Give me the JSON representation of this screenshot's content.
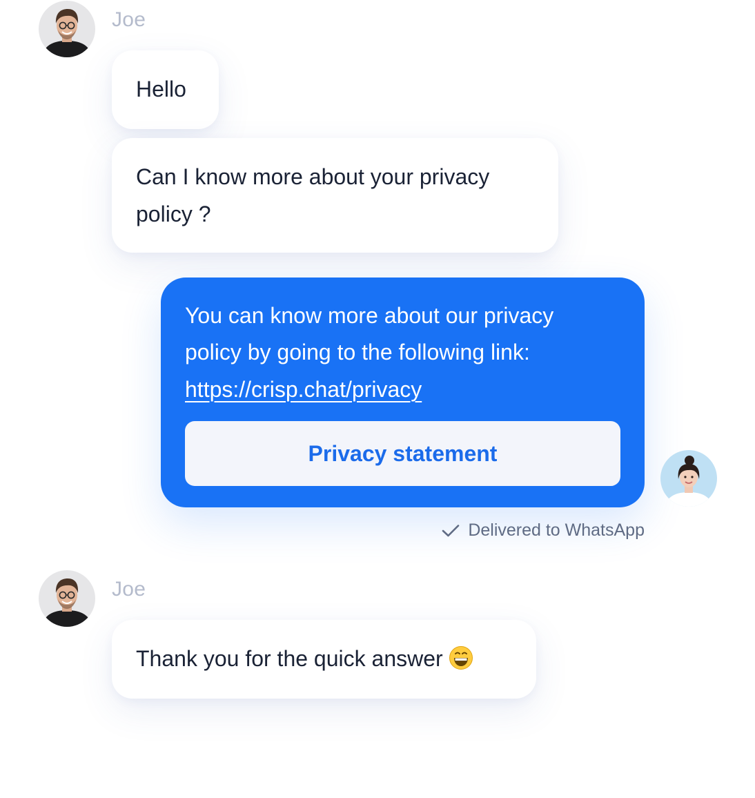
{
  "conversation": {
    "first_group": {
      "sender": "Joe",
      "messages": [
        "Hello",
        "Can I know more about your privacy\npolicy ?"
      ]
    },
    "operator_reply": {
      "text": "You can know more about our privacy\npolicy by going to the following link:",
      "link": "https://crisp.chat/privacy",
      "button_label": "Privacy statement",
      "status": "Delivered to WhatsApp"
    },
    "second_group": {
      "sender": "Joe",
      "message": "Thank you for the quick answer"
    }
  },
  "icons": {
    "status": "checkmark-icon",
    "emoji": "grinning-face-icon",
    "user_avatar": "joe-avatar",
    "operator_avatar": "operator-avatar"
  },
  "colors": {
    "reply_bubble": "#1972f5",
    "button_background": "#f3f5fb",
    "button_text": "#1b6bea",
    "sender_name": "#b4bbcc",
    "message_text": "#1a2235"
  }
}
